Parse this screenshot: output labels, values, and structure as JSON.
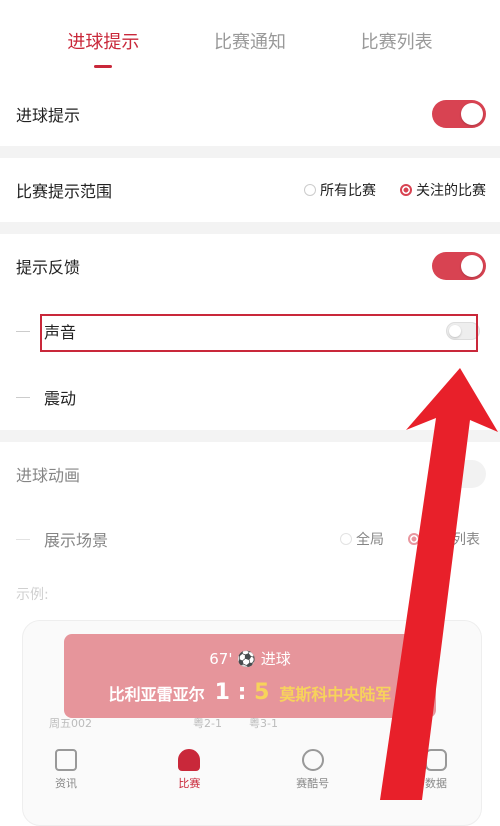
{
  "tabs": [
    {
      "label": "进球提示",
      "active": true
    },
    {
      "label": "比赛通知",
      "active": false
    },
    {
      "label": "比赛列表",
      "active": false
    }
  ],
  "settings": {
    "goal_alert": {
      "label": "进球提示",
      "on": true
    },
    "range": {
      "label": "比赛提示范围",
      "options": [
        "所有比赛",
        "关注的比赛"
      ],
      "selected": "关注的比赛"
    },
    "feedback": {
      "label": "提示反馈",
      "on": true
    },
    "sound": {
      "label": "声音",
      "on": false
    },
    "vibrate": {
      "label": "震动"
    },
    "animation": {
      "label": "进球动画",
      "on": false
    },
    "scene": {
      "label": "展示场景",
      "options": [
        "全局",
        "比赛列表"
      ],
      "selected": "比赛列表"
    },
    "example_label": "示例:"
  },
  "toast": {
    "minute": "67'",
    "event": "进球",
    "home": "比利亚雷亚尔",
    "home_score": "1",
    "away_score": "5",
    "away": "莫斯科中央陆军"
  },
  "preview_rows": [
    "周五002",
    "粤2-1",
    "粤3-1"
  ],
  "bottom_nav": [
    {
      "label": "资讯",
      "active": false
    },
    {
      "label": "比赛",
      "active": true
    },
    {
      "label": "赛酷号",
      "active": false
    },
    {
      "label": "数据",
      "active": false
    }
  ],
  "colors": {
    "accent": "#c9283a",
    "toggle_on": "#d84352",
    "score_highlight": "#f7d35b"
  }
}
